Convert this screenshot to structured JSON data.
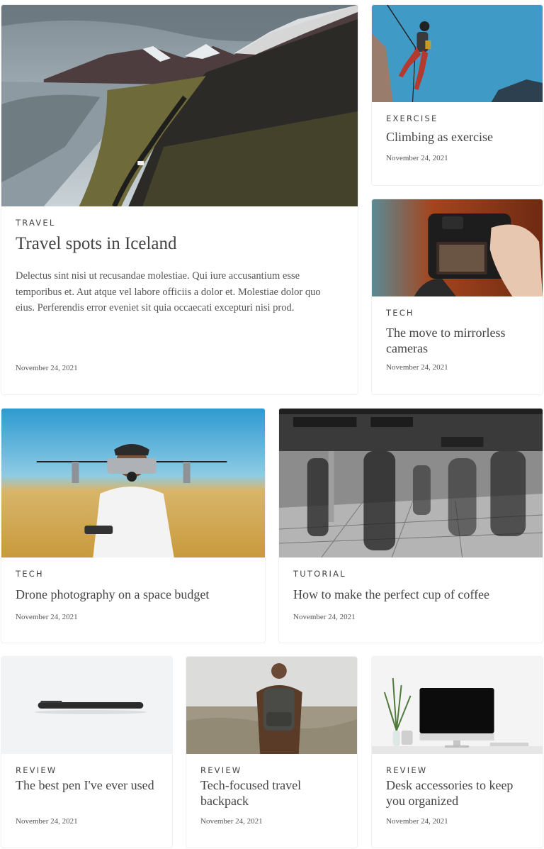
{
  "posts": [
    {
      "category": "TRAVEL",
      "title": "Travel spots in Iceland",
      "excerpt": "Delectus sint nisi ut recusandae molestiae. Qui iure accusantium esse temporibus et. Aut atque vel labore officiis a dolor et. Molestiae dolor quo eius. Perferendis error eveniet sit quia occaecati excepturi nisi prod.",
      "date": "November 24, 2021",
      "image": "iceland-mountain-road-photo"
    },
    {
      "category": "EXERCISE",
      "title": "Climbing as exercise",
      "date": "November 24, 2021",
      "image": "rock-climber-photo"
    },
    {
      "category": "TECH",
      "title": "The move to mirrorless cameras",
      "date": "November 24, 2021",
      "image": "mirrorless-camera-photo"
    },
    {
      "category": "TECH",
      "title": "Drone photography on a space budget",
      "date": "November 24, 2021",
      "image": "drone-photo"
    },
    {
      "category": "TUTORIAL",
      "title": "How to make the perfect cup of coffee",
      "date": "November 24, 2021",
      "image": "train-station-crowd-photo"
    },
    {
      "category": "REVIEW",
      "title": "The best pen I've ever used",
      "date": "November 24, 2021",
      "image": "black-pen-photo"
    },
    {
      "category": "REVIEW",
      "title": "Tech-focused travel backpack",
      "date": "November 24, 2021",
      "image": "backpack-hiker-photo"
    },
    {
      "category": "REVIEW",
      "title": "Desk accessories to keep you organized",
      "date": "November 24, 2021",
      "image": "desk-monitor-photo"
    }
  ]
}
